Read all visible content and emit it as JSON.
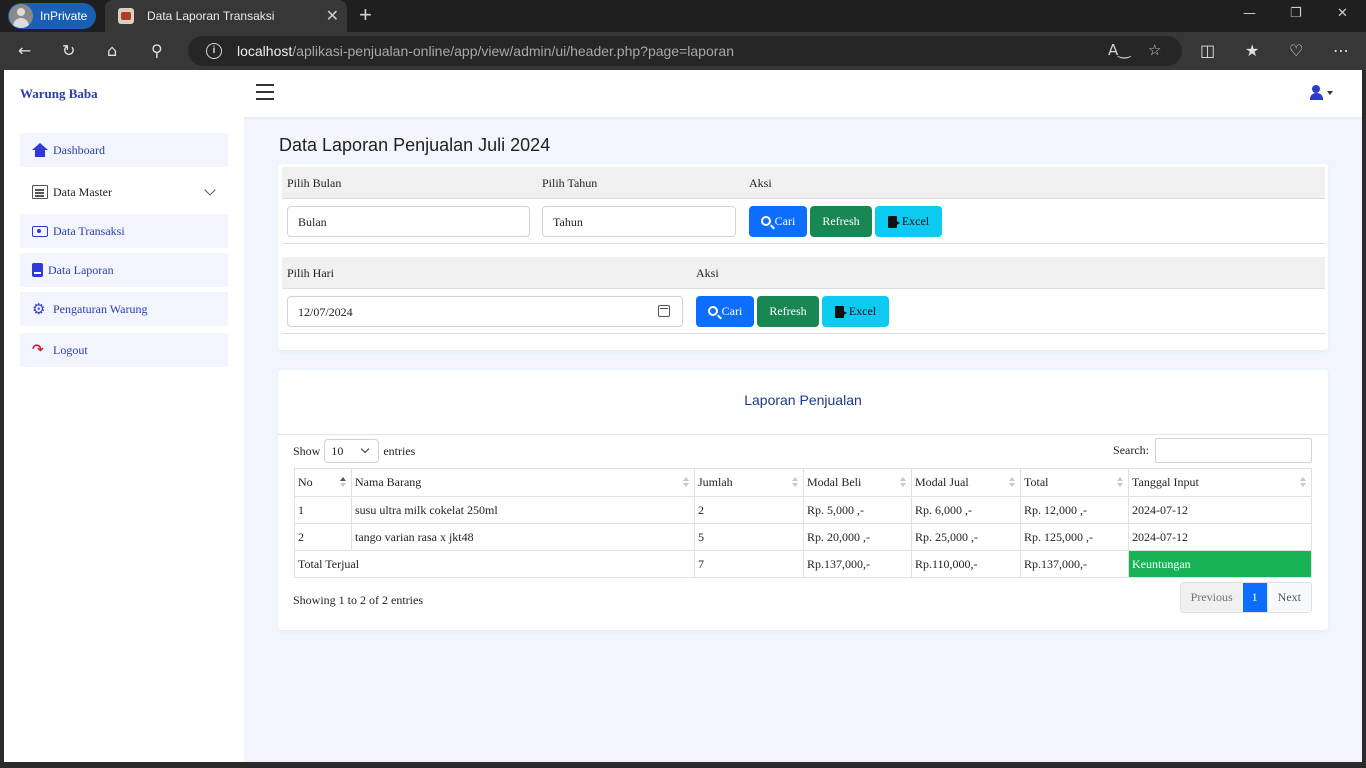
{
  "browser": {
    "inprivate_label": "InPrivate",
    "tab_title": "Data Laporan Transaksi",
    "tab_close": "✕",
    "new_tab": "+",
    "url_host": "localhost",
    "url_path": "/aplikasi-penjualan-online/app/view/admin/ui/header.php?page=laporan",
    "info_glyph": "i",
    "icons": [
      "back-icon",
      "refresh-icon",
      "home-icon",
      "search-icon",
      "read-aloud-icon",
      "favorite-icon",
      "split-screen-icon",
      "favorites-icon",
      "browser-essentials-icon",
      "more-icon"
    ]
  },
  "topnav": {
    "brand": "Warung Baba"
  },
  "sidebar": {
    "items": [
      {
        "label": "Dashboard",
        "icon": "home-icon"
      },
      {
        "label": "Data Master",
        "icon": "list-icon"
      },
      {
        "label": "Data Transaksi",
        "icon": "transaction-icon"
      },
      {
        "label": "Data Laporan",
        "icon": "report-icon"
      },
      {
        "label": "Pengaturan Warung",
        "icon": "gear-icon"
      },
      {
        "label": "Logout",
        "icon": "logout-icon"
      }
    ]
  },
  "main": {
    "title": "Data Laporan Penjualan Juli 2024",
    "filter_month": {
      "col_month": "Pilih Bulan",
      "col_year": "Pilih Tahun",
      "col_action": "Aksi",
      "month_value": "Bulan",
      "year_value": "Tahun"
    },
    "filter_day": {
      "col_day": "Pilih Hari",
      "col_action": "Aksi",
      "date_value": "12/07/2024"
    },
    "buttons": {
      "cari": "Cari",
      "refresh": "Refresh",
      "excel": "Excel"
    },
    "report": {
      "title": "Laporan Penjualan",
      "show_label": "Show",
      "entries_value": "10",
      "entries_label": "entries",
      "search_label": "Search:",
      "columns": [
        "No",
        "Nama Barang",
        "Jumlah",
        "Modal Beli",
        "Modal Jual",
        "Total",
        "Tanggal Input"
      ],
      "rows": [
        [
          "1",
          "susu ultra milk cokelat 250ml",
          "2",
          "Rp. 5,000 ,-",
          "Rp. 6,000 ,-",
          "Rp. 12,000 ,-",
          "2024-07-12"
        ],
        [
          "2",
          "tango varian rasa x jkt48",
          "5",
          "Rp. 20,000 ,-",
          "Rp. 25,000 ,-",
          "Rp. 125,000 ,-",
          "2024-07-12"
        ]
      ],
      "footer": {
        "label": "Total Terjual",
        "jumlah": "7",
        "modal_beli": "Rp.137,000,-",
        "modal_jual": "Rp.110,000,-",
        "total": "Rp.137,000,-",
        "keuntungan": "Keuntungan"
      },
      "info": "Showing 1 to 2 of 2 entries",
      "pager": {
        "previous": "Previous",
        "current": "1",
        "next": "Next"
      }
    }
  },
  "colors": {
    "accent": "#2b3bd4",
    "btn_primary": "#0d6efd",
    "btn_success": "#198754",
    "btn_info": "#0dcaf0",
    "profit": "#16b255"
  }
}
